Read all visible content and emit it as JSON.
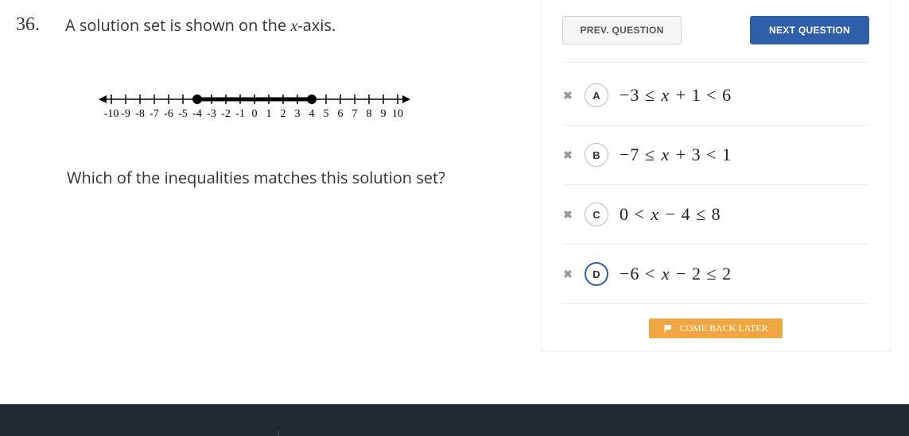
{
  "question": {
    "number": "36.",
    "prompt_prefix": "A solution set is shown on the ",
    "prompt_var": "x",
    "prompt_suffix": "-axis.",
    "subprompt": "Which of the inequalities matches this solution set?"
  },
  "numberline": {
    "min": -10,
    "max": 10,
    "labels": [
      "-10",
      "-9",
      "-8",
      "-7",
      "-6",
      "-5",
      "-4",
      "-3",
      "-2",
      "-1",
      "0",
      "1",
      "2",
      "3",
      "4",
      "5",
      "6",
      "7",
      "8",
      "9",
      "10"
    ],
    "segment": {
      "from": -4,
      "to": 4,
      "left_closed": true,
      "right_closed": true
    }
  },
  "nav": {
    "prev": "PREV. QUESTION",
    "next": "NEXT QUESTION"
  },
  "answers": [
    {
      "id": "A",
      "expr_html": "−3 ≤ <span class='var'>x</span> + 1 &lt; 6",
      "selected": false
    },
    {
      "id": "B",
      "expr_html": "−7 ≤ <span class='var'>x</span> + 3 &lt; 1",
      "selected": false
    },
    {
      "id": "C",
      "expr_html": "0 &lt; <span class='var'>x</span> − 4 ≤ 8",
      "selected": false
    },
    {
      "id": "D",
      "expr_html": "−6 &lt; <span class='var'>x</span> − 2 ≤ 2",
      "selected": true
    }
  ],
  "elim_glyph": "✖",
  "come_back": "COME BACK LATER"
}
